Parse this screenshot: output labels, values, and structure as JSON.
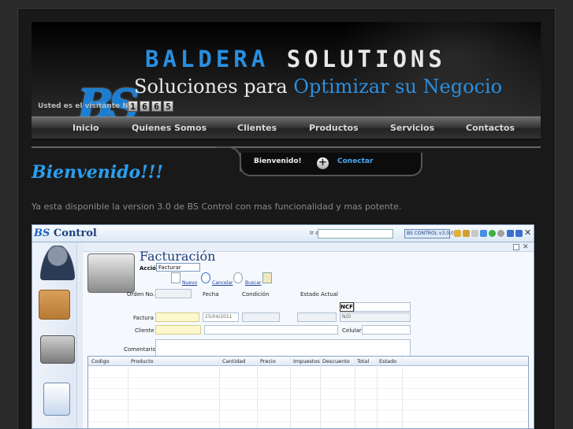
{
  "banner": {
    "brand_part1": "BALDERA",
    "brand_part2": "SOLUTIONS",
    "tagline_part1": "Soluciones para",
    "tagline_part2": "Optimizar su Negocio",
    "logo_text": "BS",
    "visitor_label": "Usted es el visitante No.",
    "visitor_digits": [
      "1",
      "6",
      "6",
      "5"
    ]
  },
  "nav": {
    "items": [
      {
        "label": "Inicio"
      },
      {
        "label": "Quienes Somos"
      },
      {
        "label": "Clientes"
      },
      {
        "label": "Productos"
      },
      {
        "label": "Servicios"
      },
      {
        "label": "Contactos"
      }
    ]
  },
  "login": {
    "welcome": "Bienvenido!",
    "connect": "Conectar"
  },
  "content": {
    "heading": "Bienvenido!!!",
    "intro": "Ya esta disponible la version 3.0 de BS Control con mas funcionalidad y mas potente."
  },
  "app": {
    "logo_bs": "BS",
    "logo_text": "Control",
    "selector_label": "Ir a:",
    "version_badge": "BS CONTROL v3.0.0.1",
    "module_title": "Facturación",
    "accion_label": "Acción",
    "accion_value": "Facturar",
    "toolbar": {
      "nuevo": "Nuevo",
      "cancelar": "Cancelar",
      "buscar": "Buscar"
    },
    "form": {
      "orden_label": "Orden No.",
      "fecha_label": "Fecha",
      "condicion_label": "Condición",
      "estado_label": "Estado Actual",
      "ncf_label": "NCF",
      "factura_label": "Factura",
      "fecha_value": "25/04/2011",
      "estado_value": "N/D",
      "cliente_label": "Cliente",
      "celular_label": "Celular",
      "comentario_label": "Comentario"
    },
    "grid_columns": [
      "Codigo",
      "Producto",
      "Cantidad",
      "Precio",
      "Impuestos",
      "Descuento",
      "Total",
      "Estado"
    ]
  },
  "colors": {
    "accent_blue": "#2a9ff0",
    "nav_text": "#d8d8d8",
    "page_bg": "#191919"
  }
}
